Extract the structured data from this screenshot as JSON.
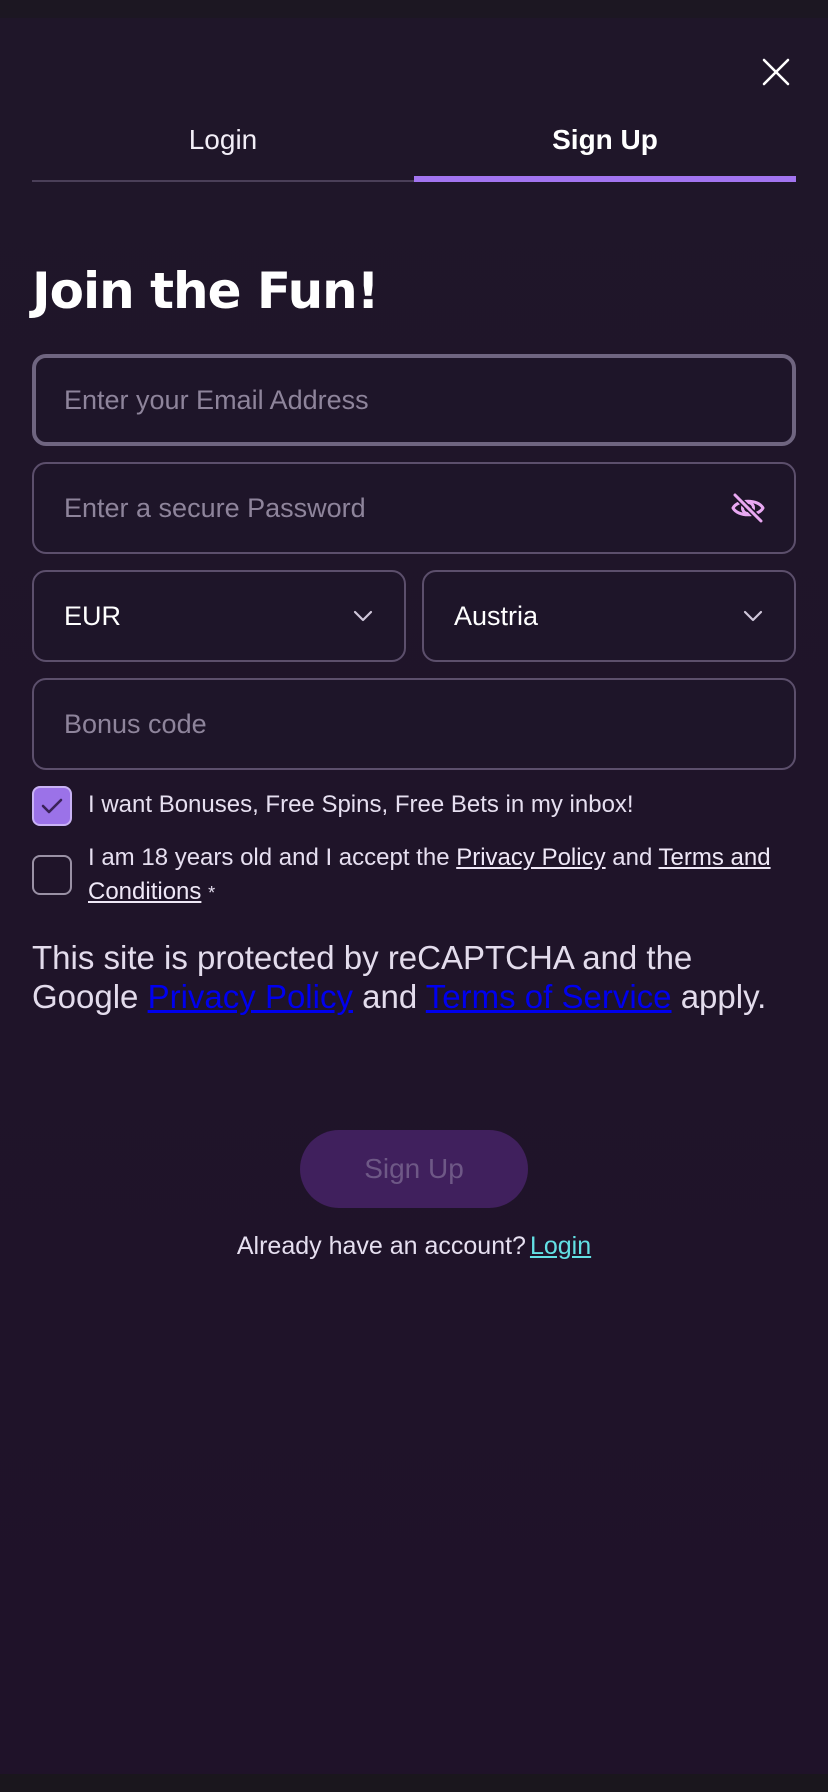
{
  "tabs": {
    "login_label": "Login",
    "signup_label": "Sign Up",
    "active": "signup"
  },
  "heading": "Join the Fun!",
  "form": {
    "email_placeholder": "Enter your Email Address",
    "email_value": "",
    "password_placeholder": "Enter a secure Password",
    "password_value": "",
    "currency_value": "EUR",
    "country_value": "Austria",
    "bonus_placeholder": "Bonus code",
    "bonus_value": ""
  },
  "checkboxes": {
    "marketing": {
      "label": "I want Bonuses, Free Spins, Free Bets in my inbox!",
      "checked": true
    },
    "terms": {
      "label_prefix": "I am 18 years old and I accept the",
      "privacy_link": "Privacy Policy",
      "and": "and",
      "terms_link": "Terms and Conditions",
      "required_mark": "*",
      "checked": false
    }
  },
  "recaptcha": {
    "prefix": "This site is protected by reCAPTCHA and the Google",
    "privacy_link": "Privacy Policy",
    "and": "and",
    "terms_link": "Terms of Service",
    "suffix": "apply."
  },
  "submit_label": "Sign Up",
  "footer": {
    "prompt": "Already have an account?",
    "login_link": "Login"
  },
  "colors": {
    "background": "#1f1629",
    "accent": "#a274f0",
    "link_cyan": "#63e0e4",
    "button_disabled": "#40205d"
  },
  "icons": {
    "close": "close-icon",
    "password_toggle": "eye-off-icon",
    "dropdown": "chevron-down-icon",
    "check": "check-icon"
  }
}
